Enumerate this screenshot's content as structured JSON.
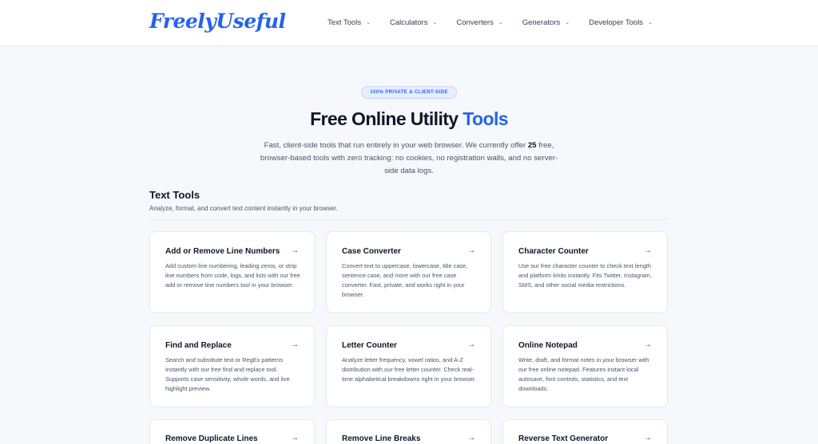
{
  "header": {
    "logo": "FreelyUseful",
    "nav": [
      {
        "label": "Text Tools"
      },
      {
        "label": "Calculators"
      },
      {
        "label": "Converters"
      },
      {
        "label": "Generators"
      },
      {
        "label": "Developer Tools"
      }
    ]
  },
  "hero": {
    "badge": "100% PRIVATE & CLIENT-SIDE",
    "title_main": "Free Online Utility ",
    "title_accent": "Tools",
    "desc_before": "Fast, client-side tools that run entirely in your web browser. We currently offer ",
    "desc_count": "25",
    "desc_after": " free, browser-based tools with zero tracking: no cookies, no registration walls, and no server-side data logs."
  },
  "section": {
    "title": "Text Tools",
    "subtitle": "Analyze, format, and convert text content instantly in your browser."
  },
  "cards": [
    {
      "title": "Add or Remove Line Numbers",
      "desc": "Add custom line numbering, leading zeros, or strip line numbers from code, logs, and lists with our free add or remove line numbers tool in your browser."
    },
    {
      "title": "Case Converter",
      "desc": "Convert text to uppercase, lowercase, title case, sentence case, and more with our free case converter. Fast, private, and works right in your browser."
    },
    {
      "title": "Character Counter",
      "desc": "Use our free character counter to check text length and platform limits instantly. Fits Twitter, Instagram, SMS, and other social media restrictions."
    },
    {
      "title": "Find and Replace",
      "desc": "Search and substitute text or RegEx patterns instantly with our free find and replace tool. Supports case sensitivity, whole words, and live highlight preview."
    },
    {
      "title": "Letter Counter",
      "desc": "Analyze letter frequency, vowel ratios, and A-Z distribution with our free letter counter. Check real-time alphabetical breakdowns right in your browser."
    },
    {
      "title": "Online Notepad",
      "desc": "Write, draft, and format notes in your browser with our free online notepad. Features instant local autosave, font controls, statistics, and text downloads."
    },
    {
      "title": "Remove Duplicate Lines",
      "desc": ""
    },
    {
      "title": "Remove Line Breaks",
      "desc": ""
    },
    {
      "title": "Reverse Text Generator",
      "desc": ""
    }
  ],
  "icons": {
    "nav_chevron": "chevron-down-icon",
    "card_arrow": "arrow-right-icon"
  },
  "colors": {
    "accent": "#2563eb",
    "background": "#f6f8fb",
    "card": "#ffffff",
    "text": "#0f172a"
  }
}
